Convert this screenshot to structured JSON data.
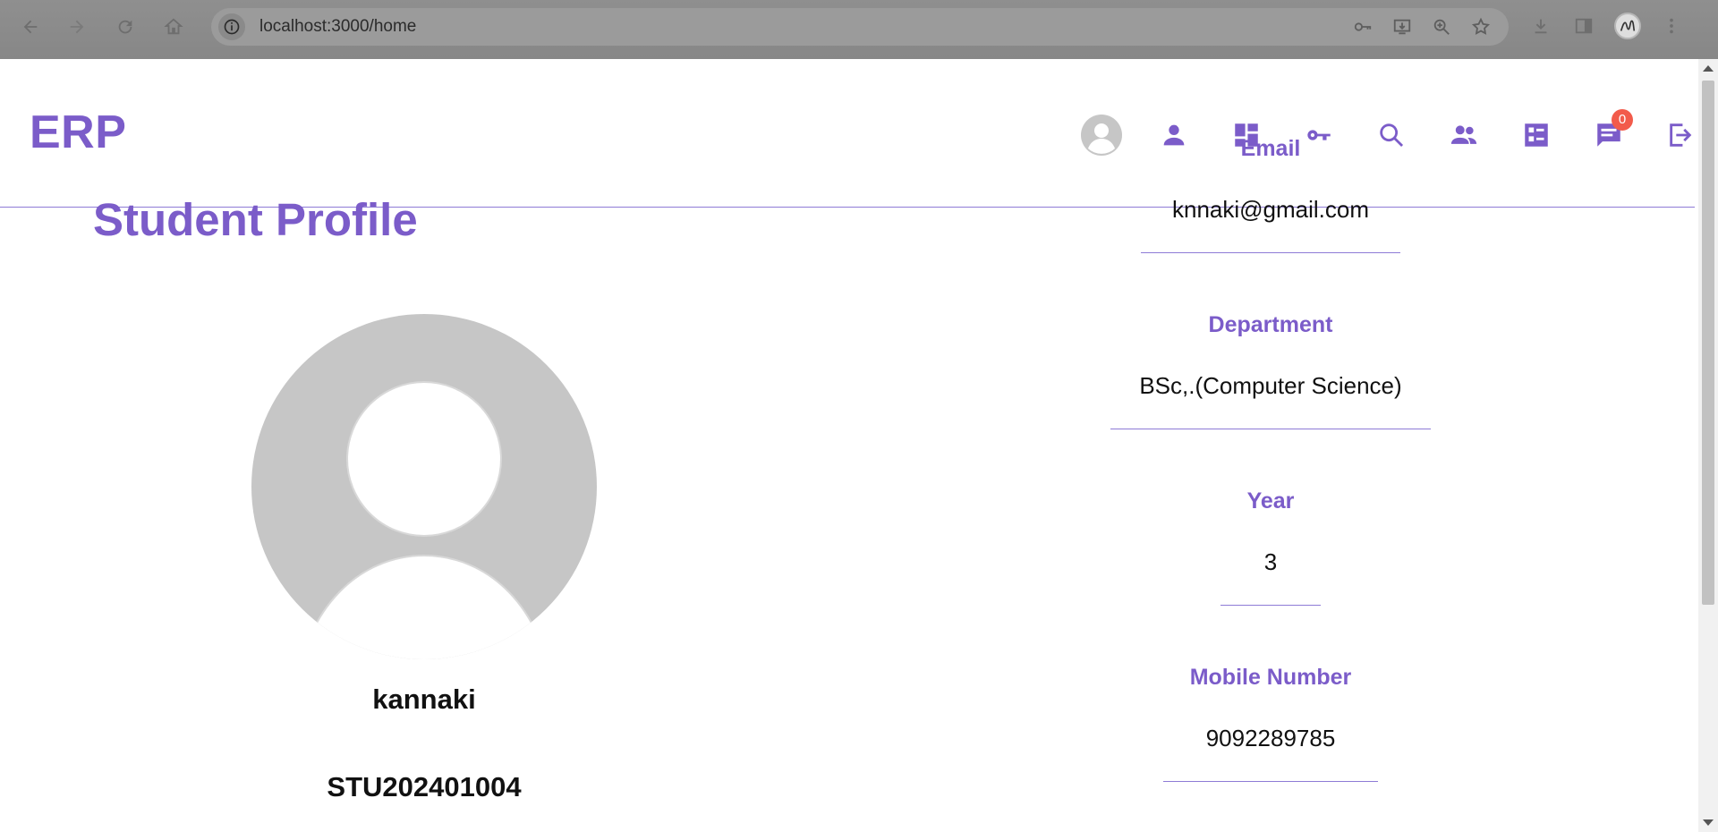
{
  "browser": {
    "url": "localhost:3000/home"
  },
  "app": {
    "brand": "ERP",
    "accent_color": "#7b5cc9",
    "nav": {
      "items": [
        {
          "name": "profile-avatar",
          "icon": "avatar-icon"
        },
        {
          "name": "person",
          "icon": "person-icon"
        },
        {
          "name": "dashboard",
          "icon": "dashboard-icon"
        },
        {
          "name": "key",
          "icon": "key-icon"
        },
        {
          "name": "search",
          "icon": "search-icon"
        },
        {
          "name": "people",
          "icon": "people-icon"
        },
        {
          "name": "checklist",
          "icon": "checklist-icon"
        },
        {
          "name": "messages",
          "icon": "chat-icon"
        },
        {
          "name": "logout",
          "icon": "logout-icon"
        }
      ],
      "notification_count": "0",
      "badge_color": "#f25b4b"
    }
  },
  "profile": {
    "title": "Student Profile",
    "name": "kannaki",
    "student_id": "STU202401004",
    "fields": {
      "email": {
        "label": "Email",
        "value": "knnaki@gmail.com"
      },
      "department": {
        "label": "Department",
        "value": "BSc,.(Computer Science)"
      },
      "year": {
        "label": "Year",
        "value": "3"
      },
      "mobile": {
        "label": "Mobile Number",
        "value": "9092289785"
      }
    }
  }
}
